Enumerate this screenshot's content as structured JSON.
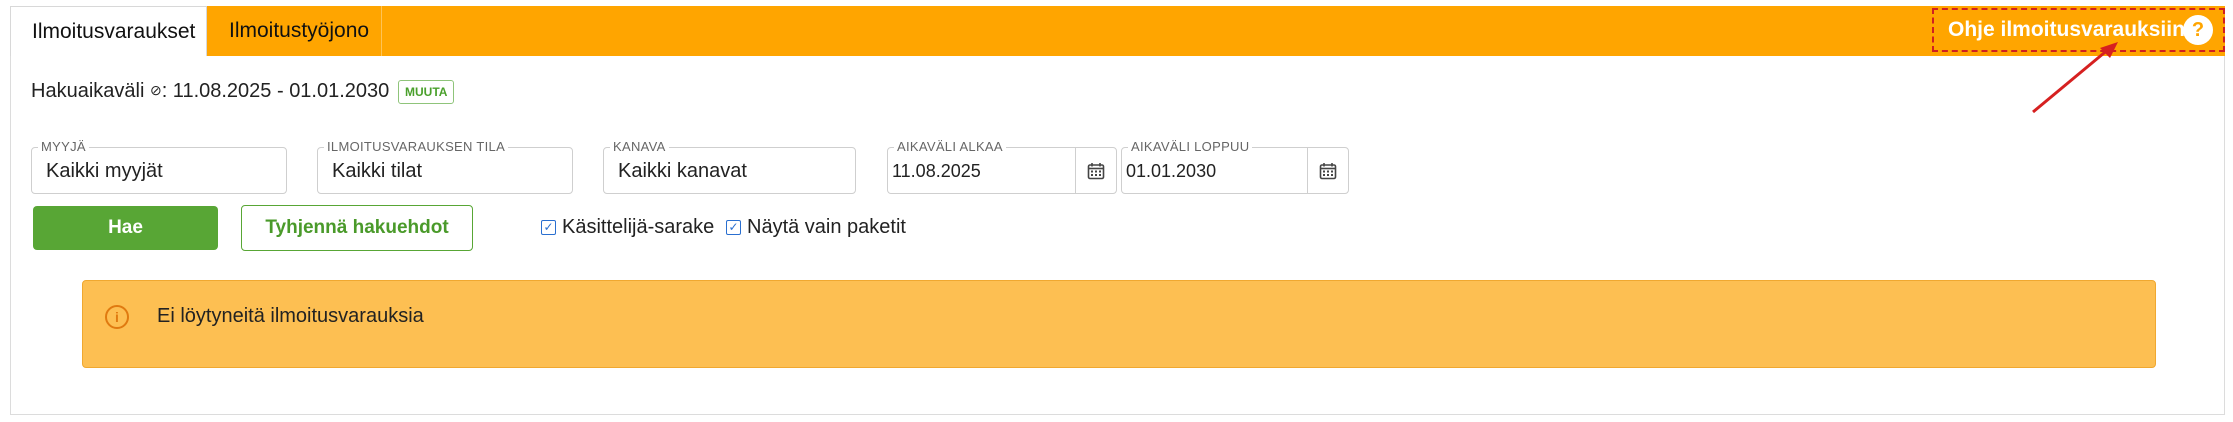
{
  "tabs": [
    {
      "label": "Ilmoitusvaraukset",
      "active": true
    },
    {
      "label": "Ilmoitustyöjono",
      "active": false
    }
  ],
  "help": {
    "label": "Ohje ilmoitusvarauksiin",
    "icon": "question-icon",
    "icon_text": "?"
  },
  "search_period": {
    "label": "Hakuaikaväli",
    "icon": "clock-icon",
    "icon_text": "⊘",
    "value": ": 11.08.2025 - 01.01.2030",
    "change_button": "MUUTA"
  },
  "filters": {
    "seller": {
      "label": "MYYJÄ",
      "value": "Kaikki myyjät"
    },
    "status": {
      "label": "ILMOITUSVARAUKSEN TILA",
      "value": "Kaikki tilat"
    },
    "channel": {
      "label": "KANAVA",
      "value": "Kaikki kanavat"
    },
    "start": {
      "label": "AIKAVÄLI ALKAA",
      "value": "11.08.2025",
      "icon": "calendar-icon"
    },
    "end": {
      "label": "AIKAVÄLI LOPPUU",
      "value": "01.01.2030",
      "icon": "calendar-icon"
    }
  },
  "actions": {
    "search": "Hae",
    "clear": "Tyhjennä hakuehdot"
  },
  "checkboxes": [
    {
      "label": "Käsittelijä-sarake",
      "checked": true
    },
    {
      "label": "Näytä vain paketit",
      "checked": true
    }
  ],
  "alert": {
    "icon": "info-icon",
    "icon_text": "i",
    "text": "Ei löytyneitä ilmoitusvarauksia"
  },
  "colors": {
    "accent": "#ffa500",
    "primary_button": "#58a635",
    "alert_bg": "#fdbf52",
    "checkbox": "#2a6fd0"
  }
}
